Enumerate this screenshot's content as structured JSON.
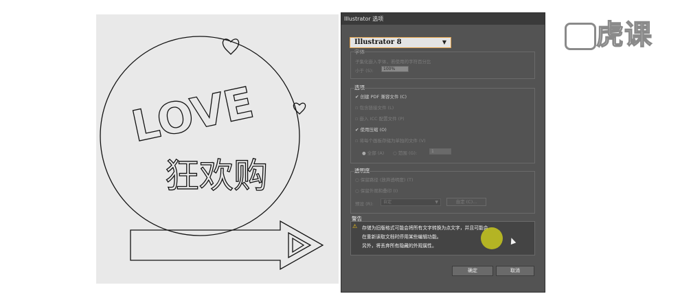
{
  "artwork": {
    "love_text": "LOVE",
    "chinese_text": "狂欢购"
  },
  "dialog": {
    "title": "Illustrator 选项",
    "version_value": "Illustrator 8",
    "fonts_group": {
      "title": "字体",
      "description": "子集化嵌入字体，若使用的字符百分比",
      "subset_label": "小于 (S):",
      "subset_value": "100%"
    },
    "options_group": {
      "title": "选项",
      "items": [
        {
          "label": "创建 PDF 兼容文件 (C)",
          "checked": true
        },
        {
          "label": "包含链接文件 (L)",
          "checked": false
        },
        {
          "label": "嵌入 ICC 配置文件 (P)",
          "checked": false
        },
        {
          "label": "使用压缩 (O)",
          "checked": true
        },
        {
          "label": "将每个画板存储为单独的文件 (V)",
          "checked": false
        }
      ],
      "all_label": "全部 (A)",
      "range_label": "范围 (G):",
      "range_value": "1"
    },
    "transparency_group": {
      "title": "透明度",
      "preserve_paths": "保留路径 (放弃透明度) (T)",
      "preserve_appearance": "保留外观和叠印 (I)",
      "preset_label": "预设 (R):",
      "preset_value": "自定",
      "custom_button": "自定 (C)..."
    },
    "warning": {
      "title": "警告",
      "line1": "存储为旧版格式可能会将所有文字转换为点文字，并且可能会",
      "line2": "在重新读取文档时停用某些编辑功能。",
      "line3": "另外，将丢弃所有隐藏的外观属性。"
    },
    "ok_label": "确定",
    "cancel_label": "取消"
  },
  "logo": {
    "text": "虎课"
  },
  "colors": {
    "dialog_bg": "#535353",
    "dropdown_border": "#e3a24a",
    "warning_icon": "#f2c316",
    "cursor_highlight": "#c8c81e"
  }
}
